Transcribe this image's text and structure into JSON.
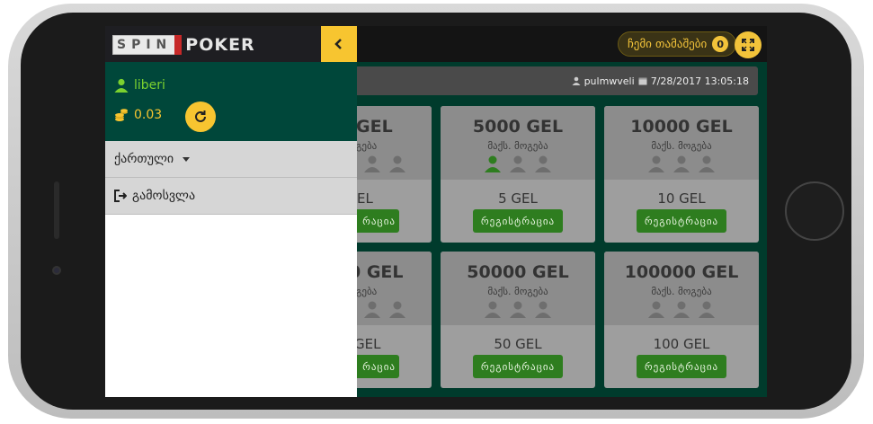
{
  "header": {
    "logo_left": "SPIN",
    "logo_right": "POKER",
    "my_games_label": "ჩემი თამაშები",
    "my_games_count": "0"
  },
  "infobar": {
    "username": "pulmwveli",
    "datetime": "7/28/2017 13:05:18"
  },
  "drawer": {
    "username": "liberi",
    "balance": "0.03",
    "language_label": "ქართული",
    "logout_label": "გამოსვლა"
  },
  "tournaments": [
    {
      "prize": "GEL",
      "subtitle": "გება",
      "fee": "EL",
      "register": "რაცია",
      "players_filled": 0
    },
    {
      "prize": "5000 GEL",
      "subtitle": "მაქს. მოგება",
      "fee": "5 GEL",
      "register": "რეგისტრაცია",
      "players_filled": 1
    },
    {
      "prize": "10000 GEL",
      "subtitle": "მაქს. მოგება",
      "fee": "10 GEL",
      "register": "რეგისტრაცია",
      "players_filled": 0
    },
    {
      "prize": "0 GEL",
      "subtitle": "გება",
      "fee": "GEL",
      "register": "რაცია",
      "players_filled": 0
    },
    {
      "prize": "50000 GEL",
      "subtitle": "მაქს. მოგება",
      "fee": "50 GEL",
      "register": "რეგისტრაცია",
      "players_filled": 0
    },
    {
      "prize": "100000 GEL",
      "subtitle": "მაქს. მოგება",
      "fee": "100 GEL",
      "register": "რეგისტრაცია",
      "players_filled": 0
    }
  ],
  "colors": {
    "accent": "#f7c530",
    "brand_green": "#00473a",
    "button_green": "#2e7d1f",
    "player_active": "#2e7d1f",
    "player_inactive": "#6e6e6e"
  },
  "icons": [
    "user-icon",
    "calendar-icon",
    "coins-icon",
    "refresh-icon",
    "chevron-left-icon",
    "fullscreen-icon",
    "logout-icon",
    "caret-down-icon"
  ]
}
